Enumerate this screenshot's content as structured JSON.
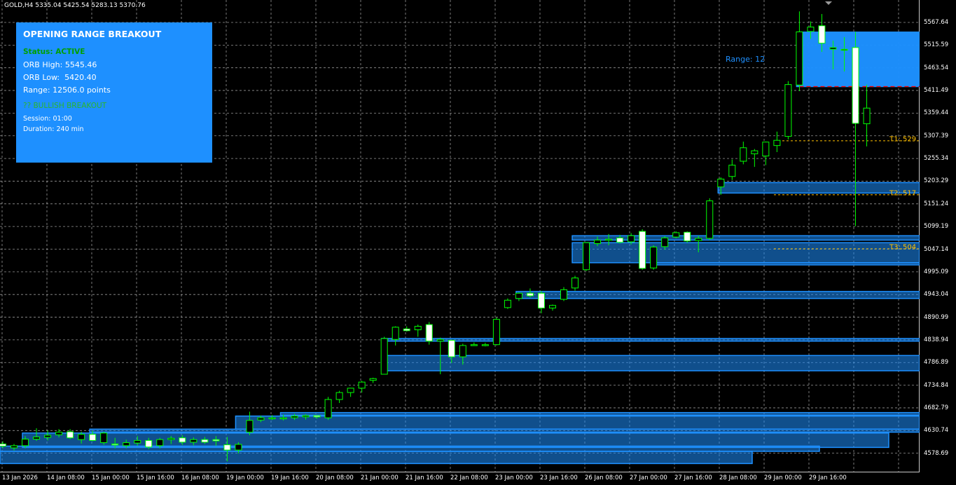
{
  "header": {
    "symbol_line": "GOLD,H4  5335.04 5425.54 5283.13 5370.76"
  },
  "price_axis": [
    "5567.64",
    "5515.59",
    "5463.54",
    "5411.49",
    "5359.44",
    "5307.39",
    "5255.34",
    "5203.29",
    "5151.24",
    "5099.19",
    "5047.14",
    "4995.09",
    "4943.04",
    "4890.99",
    "4838.94",
    "4786.89",
    "4734.84",
    "4682.79",
    "4630.74",
    "4578.69"
  ],
  "time_axis": [
    "13 Jan 2026",
    "14 Jan 08:00",
    "15 Jan 00:00",
    "15 Jan 16:00",
    "16 Jan 08:00",
    "19 Jan 00:00",
    "19 Jan 16:00",
    "20 Jan 08:00",
    "21 Jan 00:00",
    "21 Jan 16:00",
    "22 Jan 08:00",
    "23 Jan 00:00",
    "23 Jan 16:00",
    "26 Jan 08:00",
    "27 Jan 00:00",
    "27 Jan 16:00",
    "28 Jan 08:00",
    "29 Jan 00:00",
    "29 Jan 16:00"
  ],
  "panel": {
    "title": "OPENING RANGE BREAKOUT",
    "status": "Status: ACTIVE",
    "orb_high": "ORB High: 5545.46",
    "orb_low": "ORB Low:  5420.40",
    "range": "Range: 12506.0 points",
    "breakout": "?? BULLISH BREAKOUT",
    "session": "Session: 01:00",
    "duration": "Duration: 240 min"
  },
  "chart_labels": {
    "range_label": "Range: 12",
    "t1": "T1: 529",
    "t2": "T2: 517",
    "t3": "T3: 504"
  },
  "colors": {
    "background": "#000000",
    "grid": "#c8c8c8",
    "bull": "#00ff00",
    "bear_fill": "#ffffff",
    "zone": "#1e90ff",
    "target": "#ffc000",
    "orb_low_line": "#ff0000"
  },
  "chart_data": {
    "type": "candlestick",
    "symbol": "GOLD",
    "timeframe": "H4",
    "ylim": [
      4556,
      5592
    ],
    "candles": [
      {
        "o": 4600,
        "h": 4606,
        "l": 4590,
        "c": 4595
      },
      {
        "o": 4591,
        "h": 4600,
        "l": 4585,
        "c": 4596
      },
      {
        "o": 4596,
        "h": 4618,
        "l": 4590,
        "c": 4611
      },
      {
        "o": 4611,
        "h": 4636,
        "l": 4607,
        "c": 4616
      },
      {
        "o": 4615,
        "h": 4631,
        "l": 4608,
        "c": 4620
      },
      {
        "o": 4621,
        "h": 4634,
        "l": 4615,
        "c": 4627
      },
      {
        "o": 4628,
        "h": 4634,
        "l": 4611,
        "c": 4614
      },
      {
        "o": 4610,
        "h": 4628,
        "l": 4601,
        "c": 4622
      },
      {
        "o": 4622,
        "h": 4630,
        "l": 4606,
        "c": 4608
      },
      {
        "o": 4603,
        "h": 4628,
        "l": 4598,
        "c": 4625
      },
      {
        "o": 4600,
        "h": 4614,
        "l": 4590,
        "c": 4598
      },
      {
        "o": 4596,
        "h": 4610,
        "l": 4590,
        "c": 4603
      },
      {
        "o": 4602,
        "h": 4618,
        "l": 4596,
        "c": 4608
      },
      {
        "o": 4608,
        "h": 4614,
        "l": 4588,
        "c": 4593
      },
      {
        "o": 4596,
        "h": 4614,
        "l": 4590,
        "c": 4610
      },
      {
        "o": 4610,
        "h": 4618,
        "l": 4600,
        "c": 4613
      },
      {
        "o": 4614,
        "h": 4620,
        "l": 4598,
        "c": 4604
      },
      {
        "o": 4604,
        "h": 4615,
        "l": 4597,
        "c": 4610
      },
      {
        "o": 4610,
        "h": 4616,
        "l": 4600,
        "c": 4604
      },
      {
        "o": 4610,
        "h": 4618,
        "l": 4596,
        "c": 4607
      },
      {
        "o": 4598,
        "h": 4616,
        "l": 4560,
        "c": 4586
      },
      {
        "o": 4586,
        "h": 4604,
        "l": 4578,
        "c": 4599
      },
      {
        "o": 4627,
        "h": 4674,
        "l": 4620,
        "c": 4654
      },
      {
        "o": 4655,
        "h": 4665,
        "l": 4650,
        "c": 4660
      },
      {
        "o": 4660,
        "h": 4666,
        "l": 4655,
        "c": 4660
      },
      {
        "o": 4660,
        "h": 4667,
        "l": 4654,
        "c": 4660
      },
      {
        "o": 4660,
        "h": 4669,
        "l": 4655,
        "c": 4664
      },
      {
        "o": 4662,
        "h": 4668,
        "l": 4656,
        "c": 4665
      },
      {
        "o": 4665,
        "h": 4666,
        "l": 4658,
        "c": 4662
      },
      {
        "o": 4660,
        "h": 4708,
        "l": 4655,
        "c": 4702
      },
      {
        "o": 4702,
        "h": 4722,
        "l": 4694,
        "c": 4718
      },
      {
        "o": 4718,
        "h": 4728,
        "l": 4708,
        "c": 4728
      },
      {
        "o": 4728,
        "h": 4745,
        "l": 4718,
        "c": 4742
      },
      {
        "o": 4746,
        "h": 4752,
        "l": 4740,
        "c": 4750
      },
      {
        "o": 4760,
        "h": 4846,
        "l": 4760,
        "c": 4842
      },
      {
        "o": 4840,
        "h": 4870,
        "l": 4826,
        "c": 4868
      },
      {
        "o": 4864,
        "h": 4870,
        "l": 4858,
        "c": 4860
      },
      {
        "o": 4862,
        "h": 4874,
        "l": 4846,
        "c": 4870
      },
      {
        "o": 4874,
        "h": 4880,
        "l": 4828,
        "c": 4836
      },
      {
        "o": 4836,
        "h": 4844,
        "l": 4760,
        "c": 4840
      },
      {
        "o": 4838,
        "h": 4838,
        "l": 4786,
        "c": 4800
      },
      {
        "o": 4800,
        "h": 4830,
        "l": 4782,
        "c": 4826
      },
      {
        "o": 4828,
        "h": 4833,
        "l": 4825,
        "c": 4828
      },
      {
        "o": 4826,
        "h": 4832,
        "l": 4824,
        "c": 4828
      },
      {
        "o": 4828,
        "h": 4890,
        "l": 4826,
        "c": 4886
      },
      {
        "o": 4913,
        "h": 4934,
        "l": 4910,
        "c": 4930
      },
      {
        "o": 4934,
        "h": 4948,
        "l": 4928,
        "c": 4946
      },
      {
        "o": 4946,
        "h": 4957,
        "l": 4936,
        "c": 4940
      },
      {
        "o": 4946,
        "h": 4951,
        "l": 4900,
        "c": 4912
      },
      {
        "o": 4912,
        "h": 4920,
        "l": 4906,
        "c": 4918
      },
      {
        "o": 4932,
        "h": 4960,
        "l": 4928,
        "c": 4954
      },
      {
        "o": 4958,
        "h": 4986,
        "l": 4952,
        "c": 4981
      },
      {
        "o": 5000,
        "h": 5063,
        "l": 4997,
        "c": 5062
      },
      {
        "o": 5060,
        "h": 5076,
        "l": 5054,
        "c": 5068
      },
      {
        "o": 5070,
        "h": 5082,
        "l": 5056,
        "c": 5070
      },
      {
        "o": 5073,
        "h": 5080,
        "l": 5060,
        "c": 5063
      },
      {
        "o": 5064,
        "h": 5084,
        "l": 5058,
        "c": 5078
      },
      {
        "o": 5088,
        "h": 5093,
        "l": 5000,
        "c": 5003
      },
      {
        "o": 5004,
        "h": 5056,
        "l": 5000,
        "c": 5052
      },
      {
        "o": 5053,
        "h": 5077,
        "l": 5046,
        "c": 5073
      },
      {
        "o": 5075,
        "h": 5088,
        "l": 5072,
        "c": 5085
      },
      {
        "o": 5086,
        "h": 5088,
        "l": 5062,
        "c": 5066
      },
      {
        "o": 5067,
        "h": 5078,
        "l": 5040,
        "c": 5072
      },
      {
        "o": 5072,
        "h": 5164,
        "l": 5068,
        "c": 5158
      },
      {
        "o": 5190,
        "h": 5212,
        "l": 5172,
        "c": 5208
      },
      {
        "o": 5214,
        "h": 5253,
        "l": 5206,
        "c": 5240
      },
      {
        "o": 5249,
        "h": 5294,
        "l": 5242,
        "c": 5280
      },
      {
        "o": 5266,
        "h": 5277,
        "l": 5236,
        "c": 5273
      },
      {
        "o": 5261,
        "h": 5294,
        "l": 5240,
        "c": 5293
      },
      {
        "o": 5285,
        "h": 5317,
        "l": 5270,
        "c": 5297
      },
      {
        "o": 5306,
        "h": 5433,
        "l": 5299,
        "c": 5425
      },
      {
        "o": 5424,
        "h": 5593,
        "l": 5410,
        "c": 5546
      },
      {
        "o": 5547,
        "h": 5570,
        "l": 5530,
        "c": 5557
      },
      {
        "o": 5560,
        "h": 5587,
        "l": 5500,
        "c": 5520
      },
      {
        "o": 5506,
        "h": 5526,
        "l": 5460,
        "c": 5510
      },
      {
        "o": 5505,
        "h": 5534,
        "l": 5455,
        "c": 5506
      },
      {
        "o": 5510,
        "h": 5546,
        "l": 5100,
        "c": 5336
      },
      {
        "o": 5335,
        "h": 5425,
        "l": 5283,
        "c": 5371
      }
    ],
    "zones": [
      {
        "start": 71,
        "end": "right",
        "top": 5545.46,
        "bottom": 5420.4
      },
      {
        "start": 64,
        "end": "right",
        "top": 5200,
        "bottom": 5176
      },
      {
        "start": 51,
        "end": "right",
        "top": 5078,
        "bottom": 5068
      },
      {
        "start": 51,
        "end": "right",
        "top": 5062,
        "bottom": 5016
      },
      {
        "start": 58,
        "end": "right",
        "top": 5016,
        "bottom": 5011
      },
      {
        "start": 46,
        "end": "right",
        "top": 4950,
        "bottom": 4934
      },
      {
        "start": 34,
        "end": "right",
        "top": 4842,
        "bottom": 4836
      },
      {
        "start": 34,
        "end": "right",
        "top": 4803,
        "bottom": 4768
      },
      {
        "start": 25,
        "end": "right",
        "top": 4672,
        "bottom": 4666
      },
      {
        "start": 21,
        "end": "right",
        "top": 4664,
        "bottom": 4634
      },
      {
        "start": 8,
        "end": "right",
        "top": 4634,
        "bottom": 4627
      },
      {
        "start": 2,
        "end": 1269,
        "top": 4625,
        "bottom": 4592
      },
      {
        "start": 0,
        "end": 1170,
        "top": 4595,
        "bottom": 4583
      },
      {
        "start": 0,
        "end": 1074,
        "top": 4583,
        "bottom": 4555
      }
    ],
    "orb_low_dashed": 5420.4,
    "targets": [
      5296,
      5172,
      5048
    ]
  }
}
